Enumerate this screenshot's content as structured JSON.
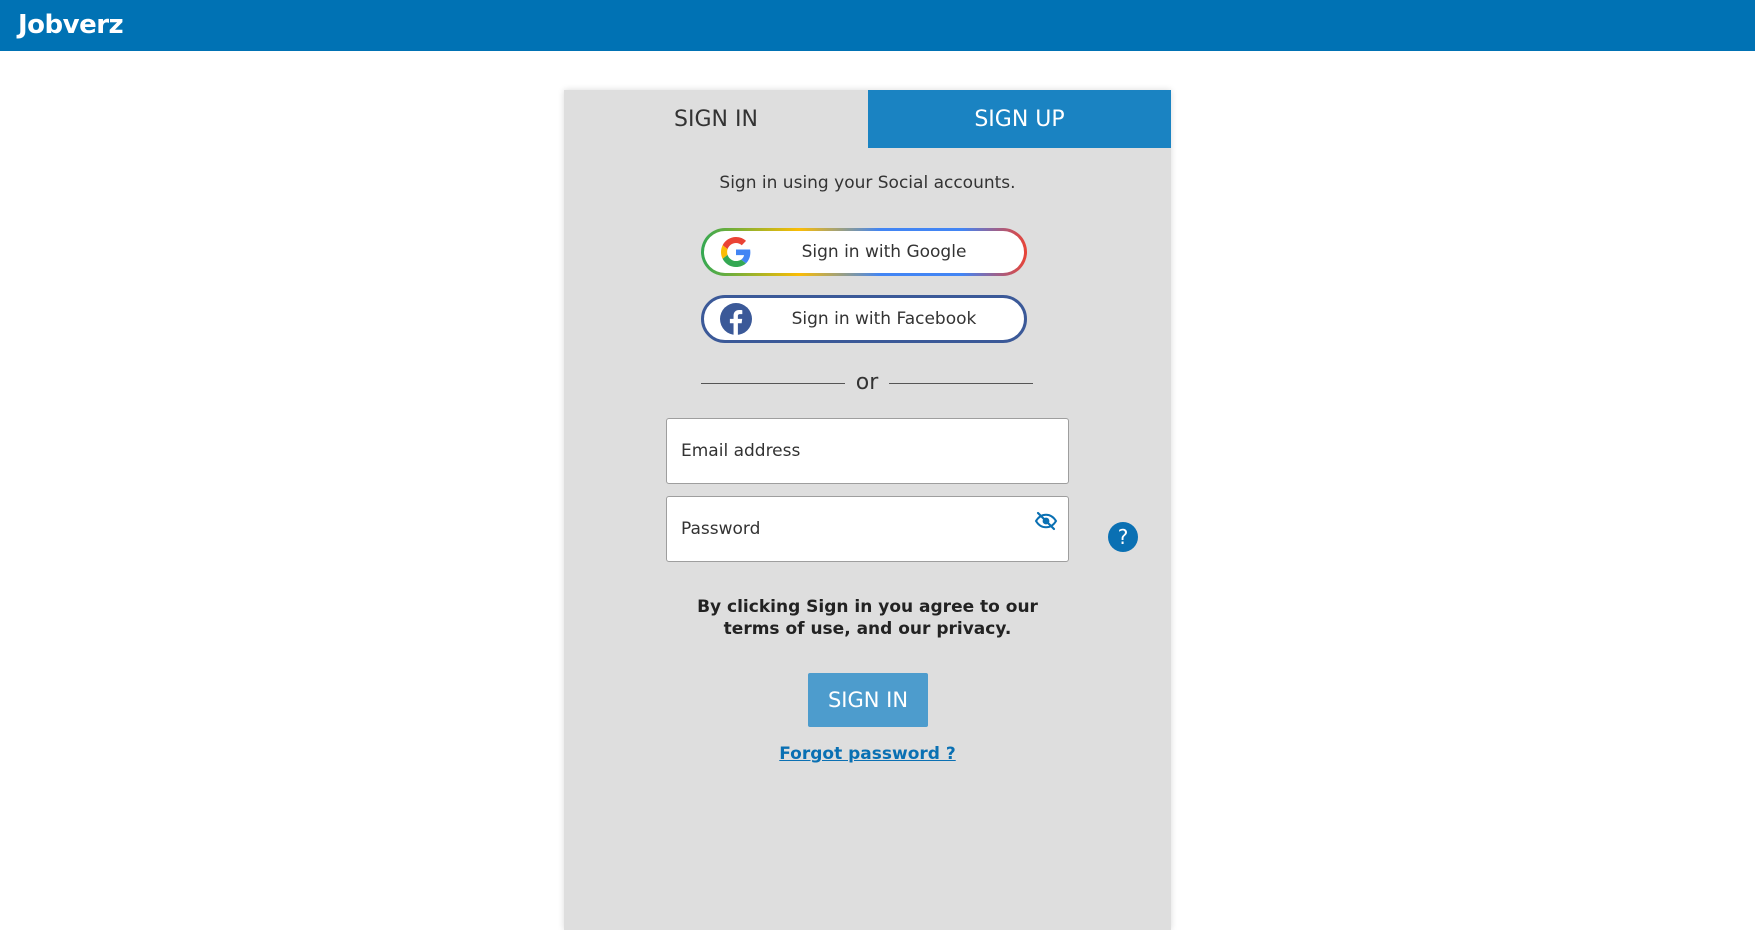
{
  "header": {
    "brand": "Jobverz",
    "background_color": "#0072b4"
  },
  "tabs": [
    {
      "label": "SIGN IN",
      "active": true
    },
    {
      "label": "SIGN UP",
      "active": false
    }
  ],
  "social": {
    "caption": "Sign in using your Social accounts.",
    "google_label": "Sign in with Google",
    "google_icon": "google-icon",
    "facebook_label": "Sign in with Facebook",
    "facebook_icon": "facebook-icon",
    "facebook_color": "#3b5998"
  },
  "divider": {
    "text": "or"
  },
  "form": {
    "email_placeholder": "Email address",
    "email_value": "",
    "password_placeholder": "Password",
    "password_value": "",
    "password_toggle_icon": "eye-slash-icon",
    "help_label": "?"
  },
  "terms": {
    "line1": "By clicking Sign in you agree to our",
    "line2": "terms of use, and our privacy."
  },
  "actions": {
    "signin_label": "SIGN IN",
    "signin_color": "#4d9ccd",
    "forgot_label": "Forgot password ?"
  }
}
